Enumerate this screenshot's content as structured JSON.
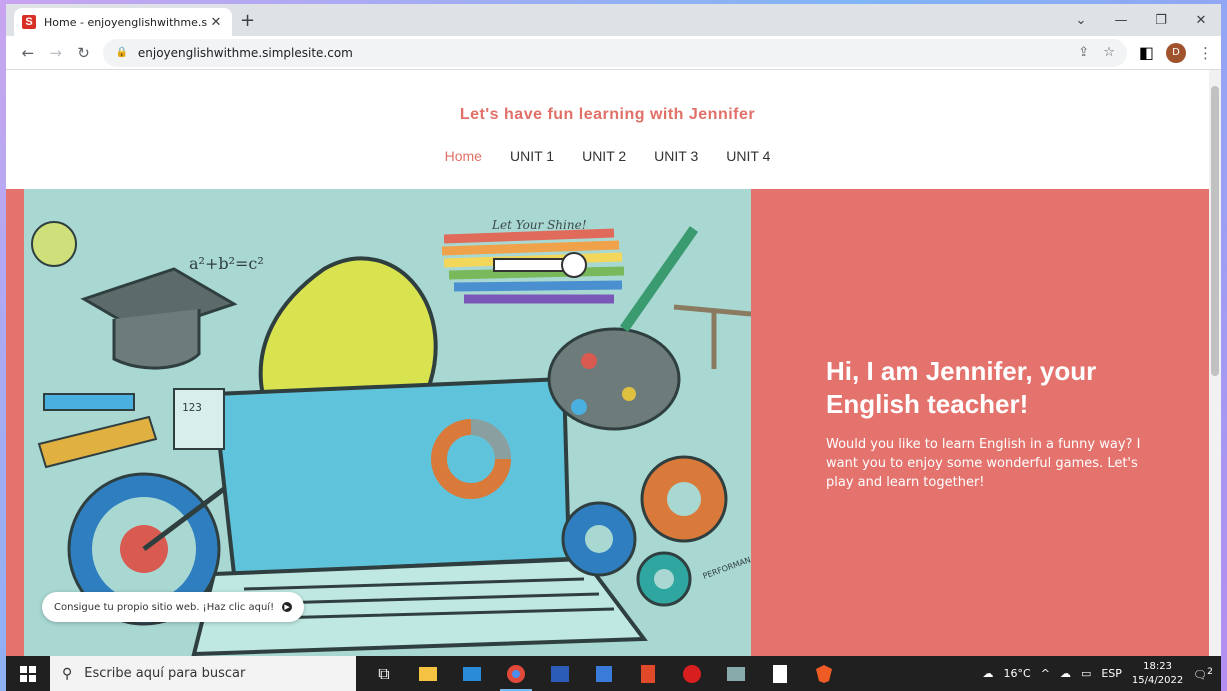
{
  "browser": {
    "tab_title": "Home - enjoyenglishwithme.simp",
    "favicon_letter": "S",
    "url": "enjoyenglishwithme.simplesite.com",
    "avatar_letter": "D"
  },
  "site": {
    "title": "Let's have fun learning with Jennifer",
    "menu": [
      "Home",
      "UNIT 1",
      "UNIT 2",
      "UNIT 3",
      "UNIT 4"
    ],
    "hero_heading": "Hi, I am Jennifer, your English teacher!",
    "hero_body": "Would you like to learn English in a funny way? I want you to enjoy some wonderful games. Let's play and learn together!",
    "illustration_texts": {
      "shine": "Let Your Shine!",
      "calculator": "123",
      "formula": "a²+b²=c²",
      "performance": "PERFORMAN"
    },
    "promo": "Consigue tu propio sitio web. ¡Haz clic aquí!"
  },
  "taskbar": {
    "search_placeholder": "Escribe aquí para buscar",
    "temperature": "16°C",
    "language": "ESP",
    "time": "18:23",
    "date": "15/4/2022",
    "notification_count": "2"
  },
  "colors": {
    "accent": "#e4736e",
    "hero_image_bg": "#a9d8d3",
    "title": "#e07068"
  }
}
